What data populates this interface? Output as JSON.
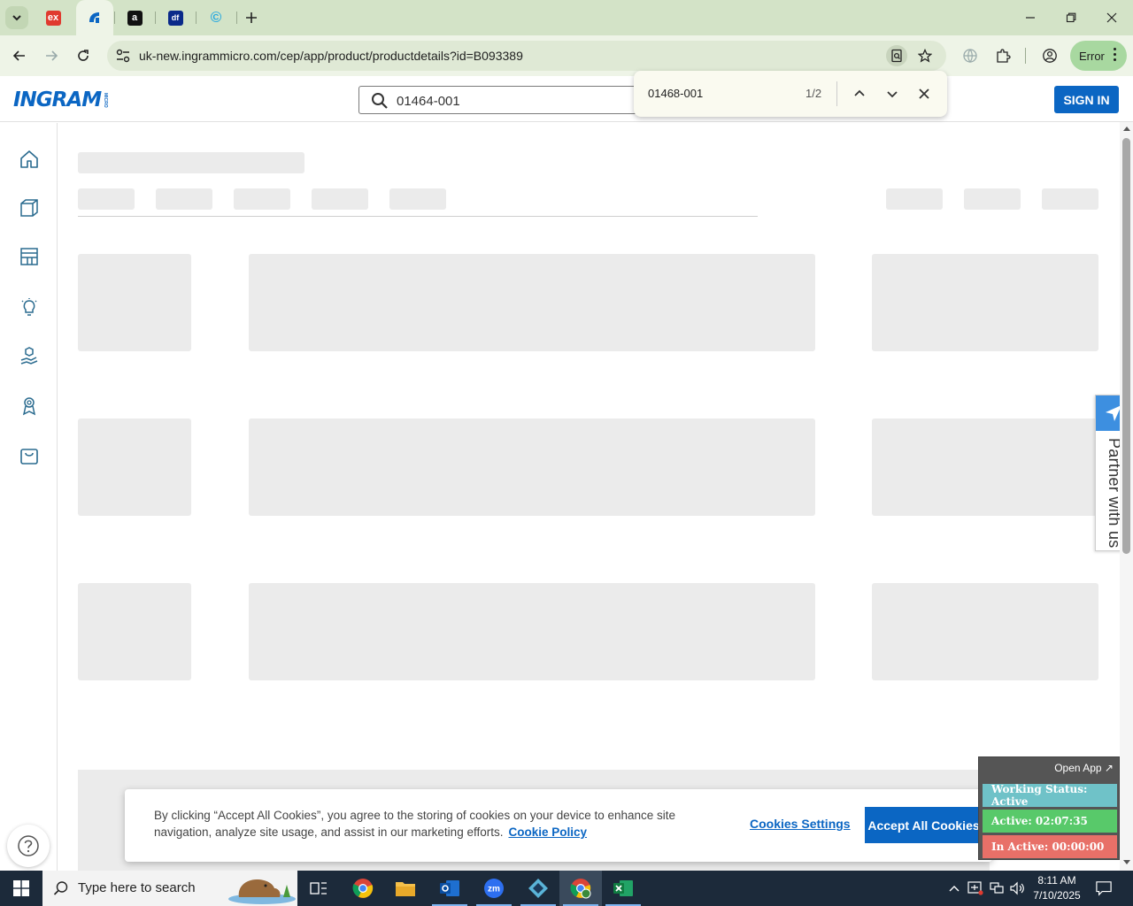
{
  "browser": {
    "tabs": [
      {
        "name": "tab-ex",
        "favicon_text": "ex",
        "color": "#e03a2f"
      },
      {
        "name": "tab-ingram",
        "favicon_text": "",
        "color": "#0b66c3",
        "active": true
      },
      {
        "name": "tab-amazon",
        "favicon_text": "a",
        "color": "#111111"
      },
      {
        "name": "tab-df",
        "favicon_text": "df",
        "color": "#0a2a8a"
      },
      {
        "name": "tab-c",
        "favicon_text": "©",
        "color": "#28a9e0"
      }
    ],
    "url": "uk-new.ingrammicro.com/cep/app/product/productdetails?id=B093389",
    "profile_chip": "Error"
  },
  "header": {
    "search_value": "01464-001",
    "sign_in_label": "SIGN IN"
  },
  "find_bar": {
    "query": "01468-001",
    "count": "1/2"
  },
  "partner": {
    "label": "Partner with us"
  },
  "cookie_banner": {
    "text": "By clicking “Accept All Cookies”, you agree to the storing of cookies on your device to enhance site navigation, analyze site usage, and assist in our marketing efforts.",
    "policy_link": "Cookie Policy",
    "settings_label": "Cookies Settings",
    "accept_label": "Accept All Cookies"
  },
  "status_widget": {
    "open_app": "Open App ↗",
    "working": "Working Status: Active",
    "active": "Active: 02:07:35",
    "inactive": "In Active: 00:00:00"
  },
  "taskbar": {
    "search_placeholder": "Type here to search",
    "time": "8:11 AM",
    "date": "7/10/2025",
    "apps": [
      "task-view-icon",
      "chrome-icon",
      "file-explorer-icon",
      "outlook-icon",
      "zoom-icon",
      "app-diamond-icon",
      "chrome-profile-icon",
      "excel-icon"
    ]
  },
  "colors": {
    "brand_blue": "#0b66c3",
    "skeleton": "#ebebeb"
  }
}
